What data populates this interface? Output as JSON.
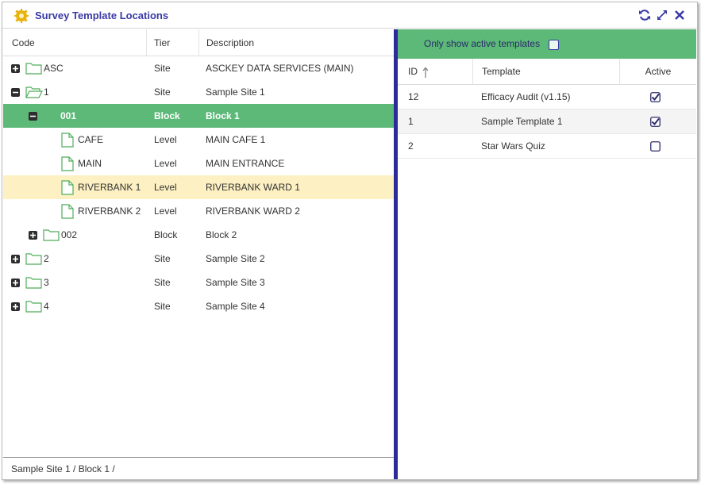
{
  "window": {
    "title": "Survey Template Locations",
    "icon": "gear-icon",
    "actions": [
      "refresh-icon",
      "maximize-icon",
      "close-icon"
    ]
  },
  "tree": {
    "columns": {
      "code": "Code",
      "tier": "Tier",
      "description": "Description"
    },
    "rows": [
      {
        "code": "ASC",
        "tier": "Site",
        "description": "ASCKEY DATA SERVICES (MAIN)",
        "type": "folder",
        "toggle": "plus"
      },
      {
        "code": "1",
        "tier": "Site",
        "description": "Sample Site 1",
        "type": "folder-open",
        "toggle": "minus"
      },
      {
        "code": "001",
        "tier": "Block",
        "description": "Block 1",
        "type": "none",
        "toggle": "minus"
      },
      {
        "code": "CAFE",
        "tier": "Level",
        "description": "MAIN CAFE 1",
        "type": "file",
        "toggle": "none"
      },
      {
        "code": "MAIN",
        "tier": "Level",
        "description": "MAIN ENTRANCE",
        "type": "file",
        "toggle": "none"
      },
      {
        "code": "RIVERBANK 1",
        "tier": "Level",
        "description": "RIVERBANK WARD 1",
        "type": "file",
        "toggle": "none"
      },
      {
        "code": "RIVERBANK 2",
        "tier": "Level",
        "description": "RIVERBANK WARD 2",
        "type": "file",
        "toggle": "none"
      },
      {
        "code": "002",
        "tier": "Block",
        "description": "Block 2",
        "type": "folder",
        "toggle": "plus"
      },
      {
        "code": "2",
        "tier": "Site",
        "description": "Sample Site 2",
        "type": "folder",
        "toggle": "plus"
      },
      {
        "code": "3",
        "tier": "Site",
        "description": "Sample Site 3",
        "type": "folder",
        "toggle": "plus"
      },
      {
        "code": "4",
        "tier": "Site",
        "description": "Sample Site 4",
        "type": "folder",
        "toggle": "plus"
      }
    ],
    "status_path": "Sample Site 1 / Block 1 /"
  },
  "templates": {
    "filter_label": "Only show active templates",
    "filter_checked": false,
    "columns": {
      "id": "ID",
      "template": "Template",
      "active": "Active"
    },
    "rows": [
      {
        "id": "12",
        "template": "Efficacy Audit (v1.15)",
        "active": true
      },
      {
        "id": "1",
        "template": "Sample Template 1",
        "active": true
      },
      {
        "id": "2",
        "template": "Star Wars Quiz",
        "active": false
      }
    ]
  },
  "colors": {
    "accent_green": "#5cb978",
    "title_blue": "#3a3aa6",
    "splitter": "#2b2b9a",
    "hover_row": "#fdf0c2"
  }
}
